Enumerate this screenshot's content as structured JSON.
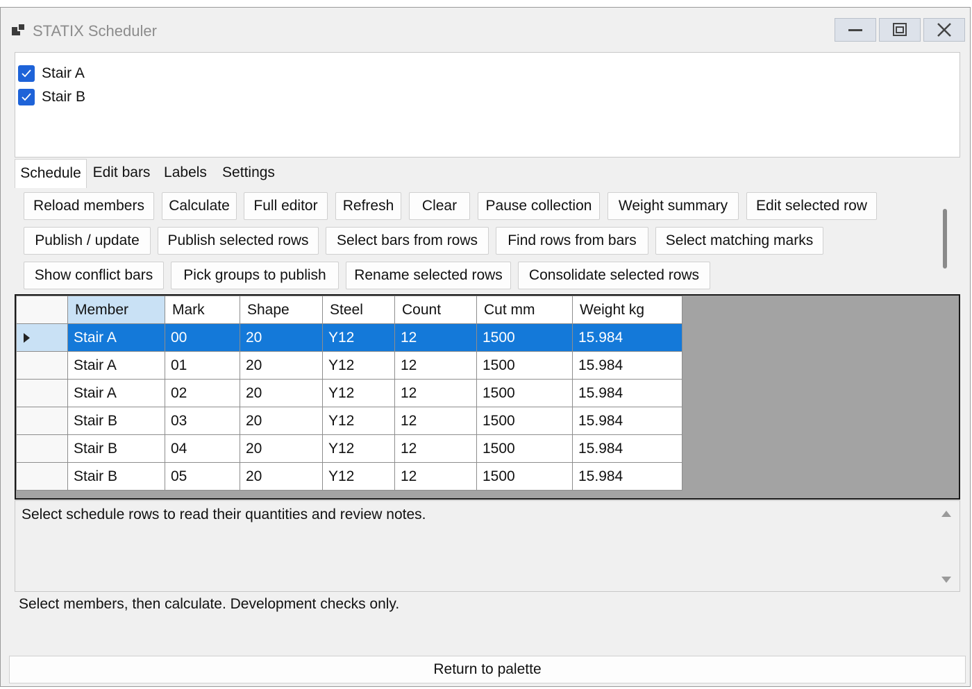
{
  "window": {
    "title": "STATIX Scheduler",
    "controls": [
      "minimize-icon",
      "restore-icon",
      "close-icon"
    ]
  },
  "members": [
    {
      "label": "Stair A",
      "checked": true
    },
    {
      "label": "Stair B",
      "checked": true
    }
  ],
  "tabs": [
    {
      "label": "Schedule",
      "active": true
    },
    {
      "label": "Edit bars",
      "active": false
    },
    {
      "label": "Labels",
      "active": false
    },
    {
      "label": "Settings",
      "active": false
    }
  ],
  "toolbar": {
    "reload_members": "Reload members",
    "calculate": "Calculate",
    "full_editor": "Full editor",
    "refresh": "Refresh",
    "clear": "Clear",
    "pause_collection": "Pause collection",
    "weight_summary": "Weight summary",
    "edit_selected_row": "Edit selected row",
    "publish_update": "Publish / update",
    "publish_selected_rows": "Publish selected rows",
    "select_bars_from_rows": "Select bars from rows",
    "find_rows_from_bars": "Find rows from bars",
    "select_matching_marks": "Select matching marks",
    "show_conflict_bars": "Show conflict bars",
    "pick_groups_to_publish": "Pick groups to publish",
    "rename_selected_rows": "Rename selected rows",
    "consolidate_selected_rows": "Consolidate selected rows"
  },
  "grid": {
    "columns": [
      "Member",
      "Mark",
      "Shape",
      "Steel",
      "Count",
      "Cut mm",
      "Weight kg"
    ],
    "rows": [
      [
        "Stair A",
        "00",
        "20",
        "Y12",
        "12",
        "1500",
        "15.984"
      ],
      [
        "Stair A",
        "01",
        "20",
        "Y12",
        "12",
        "1500",
        "15.984"
      ],
      [
        "Stair A",
        "02",
        "20",
        "Y12",
        "12",
        "1500",
        "15.984"
      ],
      [
        "Stair B",
        "03",
        "20",
        "Y12",
        "12",
        "1500",
        "15.984"
      ],
      [
        "Stair B",
        "04",
        "20",
        "Y12",
        "12",
        "1500",
        "15.984"
      ],
      [
        "Stair B",
        "05",
        "20",
        "Y12",
        "12",
        "1500",
        "15.984"
      ]
    ],
    "selected_row": 0
  },
  "notes": {
    "text": "Select schedule rows to read their quantities and review notes."
  },
  "status": {
    "text": "Select members, then calculate. Development checks only."
  },
  "footer": {
    "return_label": "Return to palette"
  },
  "colors": {
    "selection": "#1479d9",
    "checkbox": "#1e63d8",
    "header_highlight": "#c9e1f5"
  }
}
